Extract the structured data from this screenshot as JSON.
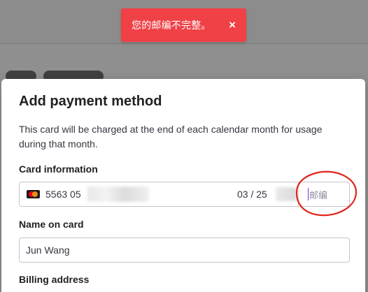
{
  "toast": {
    "message": "您的邮编不完整。",
    "close_glyph": "×",
    "color": "#ef4146"
  },
  "modal": {
    "title": "Add payment method",
    "description": "This card will be charged at the end of each calendar month for usage during that month."
  },
  "card_info": {
    "label": "Card information",
    "brand_icon": "mastercard-icon",
    "number_prefix": "5563 05",
    "expiry": "03 / 25",
    "zip_placeholder": "邮编"
  },
  "name_on_card": {
    "label": "Name on card",
    "value": "Jun Wang"
  },
  "billing": {
    "label": "Billing address"
  },
  "annotation": {
    "shape": "ellipse",
    "color": "#e0241b"
  }
}
